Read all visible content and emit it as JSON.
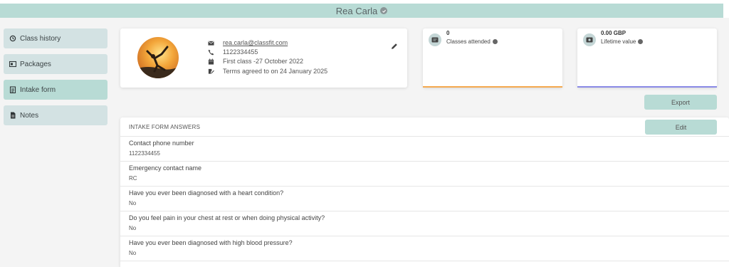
{
  "client": {
    "name": "Rea Carla"
  },
  "sidebar": {
    "items": [
      {
        "label": "Class history",
        "icon": "history-icon"
      },
      {
        "label": "Packages",
        "icon": "package-icon"
      },
      {
        "label": "Intake form",
        "icon": "clipboard-icon",
        "active": true
      },
      {
        "label": "Notes",
        "icon": "notes-icon"
      }
    ]
  },
  "profile": {
    "email": "rea.carla@classfit.com",
    "phone": "1122334455",
    "first_class": "First class -27 October 2022",
    "terms": "Terms agreed to on 24 January 2025"
  },
  "stats": {
    "classes_attended": {
      "value": "0",
      "label": "Classes attended",
      "bar_color": "#f4a94f"
    },
    "lifetime_value": {
      "value": "0.00 GBP",
      "label": "Lifetime value",
      "bar_color": "#8a8ae6"
    }
  },
  "actions": {
    "export_label": "Export",
    "edit_label": "Edit"
  },
  "intake": {
    "title": "INTAKE FORM ANSWERS",
    "answers": [
      {
        "question": "Contact phone number",
        "answer": "1122334455"
      },
      {
        "question": "Emergency contact name",
        "answer": "RC"
      },
      {
        "question": "Have you ever been diagnosed with a heart condition?",
        "answer": "No"
      },
      {
        "question": "Do you feel pain in your chest at rest or when doing physical activity?",
        "answer": "No"
      },
      {
        "question": "Have you ever been diagnosed with high blood pressure?",
        "answer": "No"
      }
    ]
  },
  "colors": {
    "accent": "#b8dbd5",
    "nav_bg": "#d3e2e3",
    "page_bg": "#f4f4f4"
  }
}
